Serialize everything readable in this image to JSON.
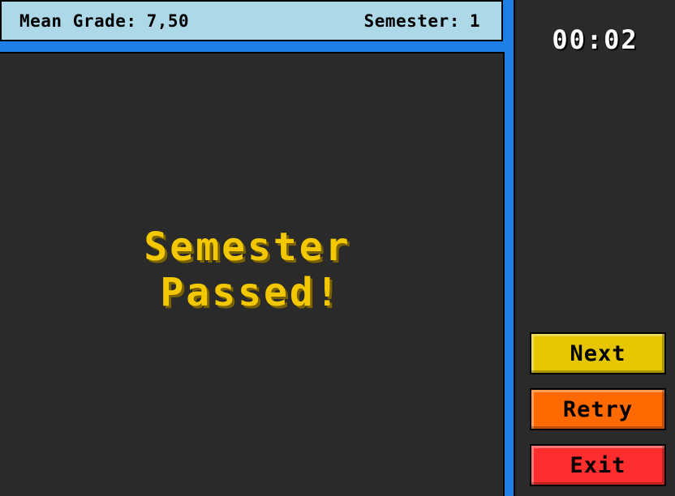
{
  "header": {
    "mean_grade_label": "Mean Grade:",
    "mean_grade_value": "7,50",
    "semester_label": "Semester:",
    "semester_value": "1"
  },
  "stage": {
    "message_line1": "Semester",
    "message_line2": "Passed!"
  },
  "sidebar": {
    "timer": "00:02",
    "buttons": {
      "next": "Next",
      "retry": "Retry",
      "exit": "Exit"
    }
  },
  "colors": {
    "frame": "#1e7fe6",
    "header_bg": "#acd8e8",
    "stage_bg": "#2a2a2a",
    "message": "#f3c800",
    "next": "#e5c600",
    "retry": "#ff6a00",
    "exit": "#ff2e2e"
  }
}
